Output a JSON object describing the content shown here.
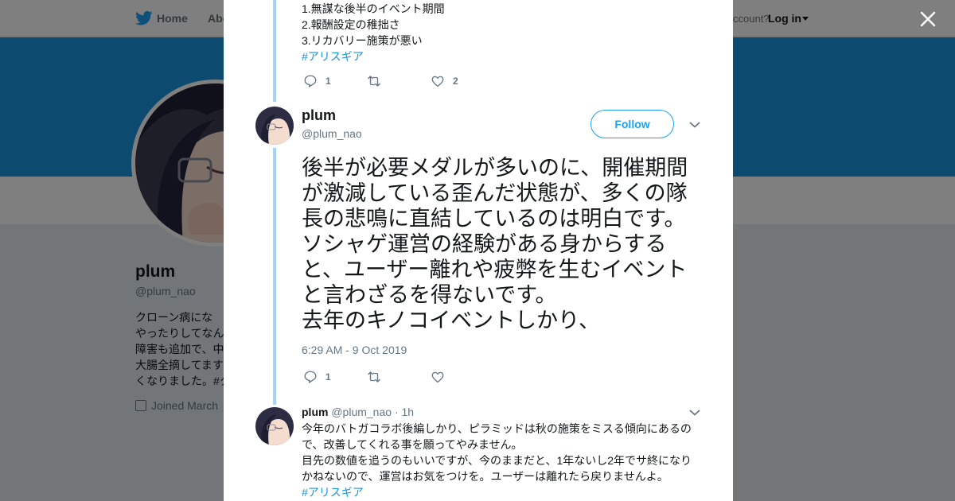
{
  "nav": {
    "home_label": "Home",
    "about_label": "Abo",
    "account_text": "ccount?",
    "login_label": "Log in"
  },
  "profile": {
    "name": "plum",
    "handle": "@plum_nao",
    "bio_lines": [
      "クローン病にな",
      "やったりしてなん",
      "障害も追加で、中",
      "大腸全摘してます",
      "くなりました。#ク"
    ],
    "joined": "Joined March"
  },
  "modal": {
    "prev_tweet": {
      "lines": [
        "1.無謀な後半のイベント期間",
        "2.報酬設定の稚拙さ",
        "3.リカバリー施策が悪い"
      ],
      "hashtag": "#アリスギア",
      "reply_count": "1",
      "like_count": "2"
    },
    "main_tweet": {
      "name": "plum",
      "handle": "@plum_nao",
      "follow_label": "Follow",
      "text": "後半が必要メダルが多いのに、開催期間が激減している歪んだ状態が、多くの隊長の悲鳴に直結しているのは明白です。\nソシャゲ運営の経験がある身からすると、ユーザー離れや疲弊を生むイベントと言わざるを得ないです。\n去年のキノコイベントしかり、",
      "timestamp": "6:29 AM - 9 Oct 2019",
      "reply_count": "1"
    },
    "reply_tweet": {
      "name": "plum",
      "handle": "@plum_nao",
      "time": "· 1h",
      "paragraphs": [
        "今年のバトガコラボ後編しかり、ピラミッドは秋の施策をミスる傾向にあるので、改善してくれる事を願ってやみません。",
        "目先の数値を追うのもいいですが、今のままだと、1年ないし2年でサ終になりかねないので、運営はお気をつけを。ユーザーは離れたら戻りませんよ。"
      ],
      "hashtag": "#アリスギア"
    }
  },
  "icons": {
    "close": "close-icon",
    "bird": "twitter-bird-icon",
    "reply": "reply-icon",
    "retweet": "retweet-icon",
    "like": "heart-icon",
    "caret": "chevron-down-icon"
  },
  "colors": {
    "accent": "#1da1f2",
    "link": "#1b95e0",
    "thread_line": "#a3d3f5",
    "banner": "#1b95e0"
  }
}
